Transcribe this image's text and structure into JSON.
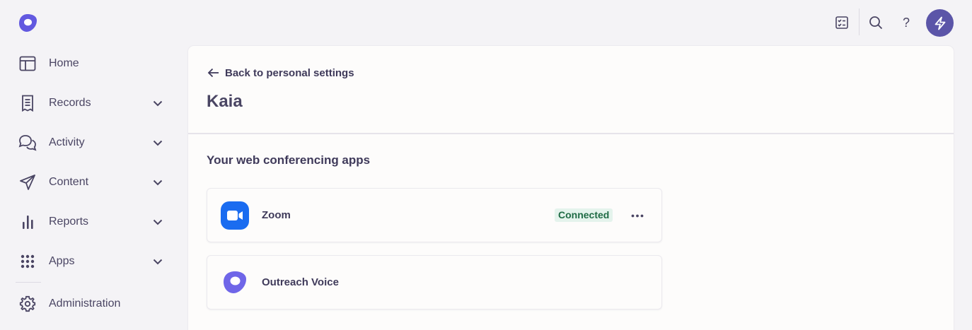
{
  "sidebar": {
    "items": [
      {
        "label": "Home",
        "icon": "home-layout-icon",
        "has_chevron": false
      },
      {
        "label": "Records",
        "icon": "records-icon",
        "has_chevron": true
      },
      {
        "label": "Activity",
        "icon": "chat-bubbles-icon",
        "has_chevron": true
      },
      {
        "label": "Content",
        "icon": "paper-plane-icon",
        "has_chevron": true
      },
      {
        "label": "Reports",
        "icon": "bar-chart-icon",
        "has_chevron": true
      },
      {
        "label": "Apps",
        "icon": "grid-dots-icon",
        "has_chevron": true
      },
      {
        "label": "Administration",
        "icon": "gear-icon",
        "has_chevron": false
      }
    ]
  },
  "topbar": {
    "help_glyph": "?"
  },
  "main": {
    "back_label": "Back to personal settings",
    "title": "Kaia",
    "section_title": "Your web conferencing apps",
    "apps": [
      {
        "name": "Zoom",
        "status": "Connected",
        "icon": "zoom-icon"
      },
      {
        "name": "Outreach Voice",
        "status": "",
        "icon": "outreach-logo-icon"
      }
    ]
  },
  "colors": {
    "brand": "#5b55a8",
    "zoom": "#1a6cf0",
    "connected_bg": "#e4f3ec",
    "connected_text": "#1f6b45"
  }
}
